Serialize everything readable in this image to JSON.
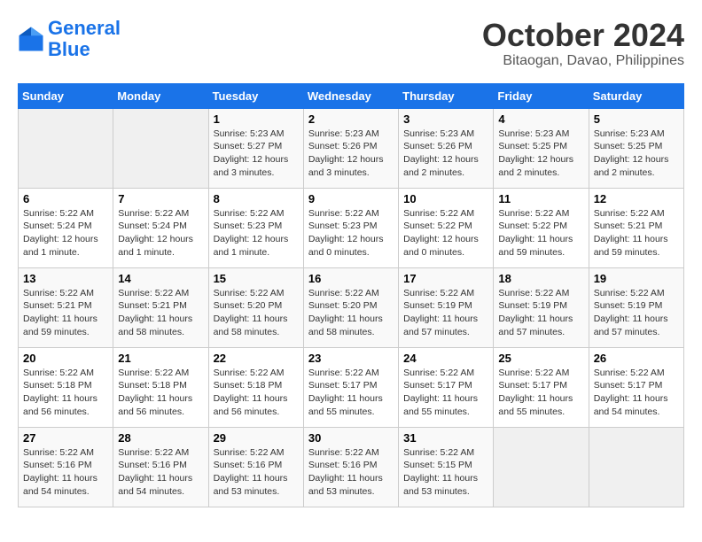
{
  "header": {
    "logo_line1": "General",
    "logo_line2": "Blue",
    "month": "October 2024",
    "location": "Bitaogan, Davao, Philippines"
  },
  "weekdays": [
    "Sunday",
    "Monday",
    "Tuesday",
    "Wednesday",
    "Thursday",
    "Friday",
    "Saturday"
  ],
  "weeks": [
    [
      {
        "day": "",
        "info": ""
      },
      {
        "day": "",
        "info": ""
      },
      {
        "day": "1",
        "info": "Sunrise: 5:23 AM\nSunset: 5:27 PM\nDaylight: 12 hours\nand 3 minutes."
      },
      {
        "day": "2",
        "info": "Sunrise: 5:23 AM\nSunset: 5:26 PM\nDaylight: 12 hours\nand 3 minutes."
      },
      {
        "day": "3",
        "info": "Sunrise: 5:23 AM\nSunset: 5:26 PM\nDaylight: 12 hours\nand 2 minutes."
      },
      {
        "day": "4",
        "info": "Sunrise: 5:23 AM\nSunset: 5:25 PM\nDaylight: 12 hours\nand 2 minutes."
      },
      {
        "day": "5",
        "info": "Sunrise: 5:23 AM\nSunset: 5:25 PM\nDaylight: 12 hours\nand 2 minutes."
      }
    ],
    [
      {
        "day": "6",
        "info": "Sunrise: 5:22 AM\nSunset: 5:24 PM\nDaylight: 12 hours\nand 1 minute."
      },
      {
        "day": "7",
        "info": "Sunrise: 5:22 AM\nSunset: 5:24 PM\nDaylight: 12 hours\nand 1 minute."
      },
      {
        "day": "8",
        "info": "Sunrise: 5:22 AM\nSunset: 5:23 PM\nDaylight: 12 hours\nand 1 minute."
      },
      {
        "day": "9",
        "info": "Sunrise: 5:22 AM\nSunset: 5:23 PM\nDaylight: 12 hours\nand 0 minutes."
      },
      {
        "day": "10",
        "info": "Sunrise: 5:22 AM\nSunset: 5:22 PM\nDaylight: 12 hours\nand 0 minutes."
      },
      {
        "day": "11",
        "info": "Sunrise: 5:22 AM\nSunset: 5:22 PM\nDaylight: 11 hours\nand 59 minutes."
      },
      {
        "day": "12",
        "info": "Sunrise: 5:22 AM\nSunset: 5:21 PM\nDaylight: 11 hours\nand 59 minutes."
      }
    ],
    [
      {
        "day": "13",
        "info": "Sunrise: 5:22 AM\nSunset: 5:21 PM\nDaylight: 11 hours\nand 59 minutes."
      },
      {
        "day": "14",
        "info": "Sunrise: 5:22 AM\nSunset: 5:21 PM\nDaylight: 11 hours\nand 58 minutes."
      },
      {
        "day": "15",
        "info": "Sunrise: 5:22 AM\nSunset: 5:20 PM\nDaylight: 11 hours\nand 58 minutes."
      },
      {
        "day": "16",
        "info": "Sunrise: 5:22 AM\nSunset: 5:20 PM\nDaylight: 11 hours\nand 58 minutes."
      },
      {
        "day": "17",
        "info": "Sunrise: 5:22 AM\nSunset: 5:19 PM\nDaylight: 11 hours\nand 57 minutes."
      },
      {
        "day": "18",
        "info": "Sunrise: 5:22 AM\nSunset: 5:19 PM\nDaylight: 11 hours\nand 57 minutes."
      },
      {
        "day": "19",
        "info": "Sunrise: 5:22 AM\nSunset: 5:19 PM\nDaylight: 11 hours\nand 57 minutes."
      }
    ],
    [
      {
        "day": "20",
        "info": "Sunrise: 5:22 AM\nSunset: 5:18 PM\nDaylight: 11 hours\nand 56 minutes."
      },
      {
        "day": "21",
        "info": "Sunrise: 5:22 AM\nSunset: 5:18 PM\nDaylight: 11 hours\nand 56 minutes."
      },
      {
        "day": "22",
        "info": "Sunrise: 5:22 AM\nSunset: 5:18 PM\nDaylight: 11 hours\nand 56 minutes."
      },
      {
        "day": "23",
        "info": "Sunrise: 5:22 AM\nSunset: 5:17 PM\nDaylight: 11 hours\nand 55 minutes."
      },
      {
        "day": "24",
        "info": "Sunrise: 5:22 AM\nSunset: 5:17 PM\nDaylight: 11 hours\nand 55 minutes."
      },
      {
        "day": "25",
        "info": "Sunrise: 5:22 AM\nSunset: 5:17 PM\nDaylight: 11 hours\nand 55 minutes."
      },
      {
        "day": "26",
        "info": "Sunrise: 5:22 AM\nSunset: 5:17 PM\nDaylight: 11 hours\nand 54 minutes."
      }
    ],
    [
      {
        "day": "27",
        "info": "Sunrise: 5:22 AM\nSunset: 5:16 PM\nDaylight: 11 hours\nand 54 minutes."
      },
      {
        "day": "28",
        "info": "Sunrise: 5:22 AM\nSunset: 5:16 PM\nDaylight: 11 hours\nand 54 minutes."
      },
      {
        "day": "29",
        "info": "Sunrise: 5:22 AM\nSunset: 5:16 PM\nDaylight: 11 hours\nand 53 minutes."
      },
      {
        "day": "30",
        "info": "Sunrise: 5:22 AM\nSunset: 5:16 PM\nDaylight: 11 hours\nand 53 minutes."
      },
      {
        "day": "31",
        "info": "Sunrise: 5:22 AM\nSunset: 5:15 PM\nDaylight: 11 hours\nand 53 minutes."
      },
      {
        "day": "",
        "info": ""
      },
      {
        "day": "",
        "info": ""
      }
    ]
  ]
}
